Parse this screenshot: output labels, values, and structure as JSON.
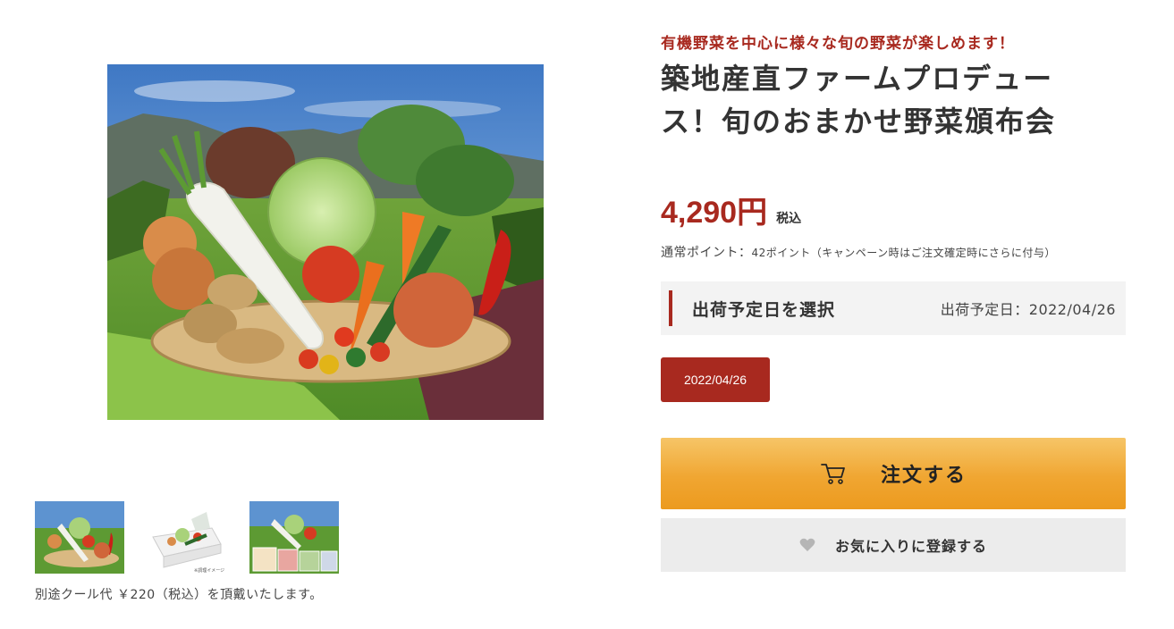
{
  "product": {
    "catchphrase": "有機野菜を中心に様々な旬の野菜が楽しめます！",
    "title": "築地産直ファームプロデュース！旬のおまかせ野菜頒布会",
    "price": "4,290円",
    "tax_label": "税込",
    "points_label": "通常ポイント：",
    "points_value": "42ポイント（キャンペーン時はご注文確定時にさらに付与）",
    "note": "別途クール代 ￥220（税込）を頂戴いたします。"
  },
  "shipping": {
    "heading": "出荷予定日を選択",
    "selected_label": "出荷予定日：2022/04/26",
    "options": [
      "2022/04/26"
    ]
  },
  "actions": {
    "order_label": "注文する",
    "favorite_label": "お気に入りに登録する"
  },
  "images": {
    "thumb2_caption": "※調理イメージ"
  },
  "colors": {
    "accent": "#a8291f",
    "order_button": "#f0a632",
    "favorite_button": "#ececec"
  }
}
